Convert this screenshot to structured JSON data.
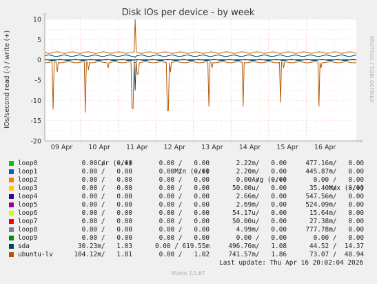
{
  "chart_data": {
    "type": "line",
    "title": "Disk IOs per device - by week",
    "ylabel": "IOs/second read (-) / write (+)",
    "ylim": [
      -20,
      10
    ],
    "yticks": [
      10,
      5,
      0,
      -5,
      -10,
      -15,
      -20
    ],
    "x_start_day": 8.55,
    "x_end_day": 16.83,
    "xticks": [
      {
        "label": "09 Apr",
        "day": 9.0
      },
      {
        "label": "10 Apr",
        "day": 10.0
      },
      {
        "label": "11 Apr",
        "day": 11.0
      },
      {
        "label": "12 Apr",
        "day": 12.0
      },
      {
        "label": "13 Apr",
        "day": 13.0
      },
      {
        "label": "14 Apr",
        "day": 14.0
      },
      {
        "label": "15 Apr",
        "day": 15.0
      },
      {
        "label": "16 Apr",
        "day": 16.0
      }
    ],
    "grid": true,
    "series": [
      {
        "name": "sda",
        "color": "#00465f",
        "write_level": 1.03,
        "read_level": -0.03,
        "spikes": [
          {
            "day": 10.95,
            "value": 0.6
          },
          {
            "day": 10.95,
            "value": -7.5
          }
        ]
      },
      {
        "name": "ubuntu-lv",
        "color": "#b35900",
        "write_level": 1.81,
        "read_level": -0.6,
        "spikes": [
          {
            "day": 8.78,
            "value": -12.2
          },
          {
            "day": 8.88,
            "value": -3.0
          },
          {
            "day": 9.63,
            "value": -13.0
          },
          {
            "day": 9.71,
            "value": -2.5
          },
          {
            "day": 10.23,
            "value": -2.0
          },
          {
            "day": 10.88,
            "value": -12.0
          },
          {
            "day": 10.95,
            "value": 10.0
          },
          {
            "day": 11.02,
            "value": -3.5
          },
          {
            "day": 11.82,
            "value": -12.5
          },
          {
            "day": 11.9,
            "value": -3.0
          },
          {
            "day": 12.92,
            "value": -11.5
          },
          {
            "day": 13.0,
            "value": -2.0
          },
          {
            "day": 13.83,
            "value": -11.5
          },
          {
            "day": 14.82,
            "value": -10.5
          },
          {
            "day": 14.9,
            "value": -2.0
          },
          {
            "day": 15.83,
            "value": -11.5
          },
          {
            "day": 15.9,
            "value": -2.0
          }
        ]
      },
      {
        "name": "loop0",
        "color": "#00cc00",
        "write_level": 0,
        "read_level": 0
      },
      {
        "name": "loop1",
        "color": "#0066b3",
        "write_level": 0,
        "read_level": 0
      },
      {
        "name": "loop2",
        "color": "#ff8000",
        "write_level": 0,
        "read_level": 0
      },
      {
        "name": "loop3",
        "color": "#ffcc00",
        "write_level": 0,
        "read_level": 0
      },
      {
        "name": "loop4",
        "color": "#330099",
        "write_level": 0,
        "read_level": 0
      },
      {
        "name": "loop5",
        "color": "#990099",
        "write_level": 0,
        "read_level": 0
      },
      {
        "name": "loop6",
        "color": "#ccff00",
        "write_level": 0,
        "read_level": 0
      },
      {
        "name": "loop7",
        "color": "#ff0000",
        "write_level": 0,
        "read_level": 0
      },
      {
        "name": "loop8",
        "color": "#808080",
        "write_level": 0,
        "read_level": 0
      },
      {
        "name": "loop9",
        "color": "#008f00",
        "write_level": 0,
        "read_level": 0
      }
    ]
  },
  "side_label": "RRDTOOL / TOBI OETIKER",
  "legend": {
    "headers": {
      "cur": "Cur (-/+)",
      "min": "Min (-/+)",
      "avg": "Avg (-/+)",
      "max": "Max (-/+)"
    },
    "rows": [
      {
        "name": "loop0",
        "color": "#00cc00",
        "cur": "0.00 /   0.00",
        "min": "0.00 /   0.00",
        "avg": "2.22m/   0.00",
        "max": "477.16m/   0.00"
      },
      {
        "name": "loop1",
        "color": "#0066b3",
        "cur": "0.00 /   0.00",
        "min": "0.00 /   0.00",
        "avg": "2.20m/   0.00",
        "max": "445.87m/   0.00"
      },
      {
        "name": "loop2",
        "color": "#ff8000",
        "cur": "0.00 /   0.00",
        "min": "0.00 /   0.00",
        "avg": "0.00 /   0.00",
        "max": "0.00 /   0.00"
      },
      {
        "name": "loop3",
        "color": "#ffcc00",
        "cur": "0.00 /   0.00",
        "min": "0.00 /   0.00",
        "avg": "50.00u/   0.00",
        "max": "35.40m/   0.00"
      },
      {
        "name": "loop4",
        "color": "#330099",
        "cur": "0.00 /   0.00",
        "min": "0.00 /   0.00",
        "avg": "2.66m/   0.00",
        "max": "547.56m/   0.00"
      },
      {
        "name": "loop5",
        "color": "#990099",
        "cur": "0.00 /   0.00",
        "min": "0.00 /   0.00",
        "avg": "2.69m/   0.00",
        "max": "524.09m/   0.00"
      },
      {
        "name": "loop6",
        "color": "#ccff00",
        "cur": "0.00 /   0.00",
        "min": "0.00 /   0.00",
        "avg": "54.17u/   0.00",
        "max": "15.64m/   0.00"
      },
      {
        "name": "loop7",
        "color": "#ff0000",
        "cur": "0.00 /   0.00",
        "min": "0.00 /   0.00",
        "avg": "50.00u/   0.00",
        "max": "27.38m/   0.00"
      },
      {
        "name": "loop8",
        "color": "#808080",
        "cur": "0.00 /   0.00",
        "min": "0.00 /   0.00",
        "avg": "4.99m/   0.00",
        "max": "777.78m/   0.00"
      },
      {
        "name": "loop9",
        "color": "#008f00",
        "cur": "0.00 /   0.00",
        "min": "0.00 /   0.00",
        "avg": "0.00 /   0.00",
        "max": "0.00 /   0.00"
      },
      {
        "name": "sda",
        "color": "#00465f",
        "cur": "30.23m/   1.03",
        "min": "0.00 / 619.55m",
        "avg": "496.76m/   1.08",
        "max": "44.52 /  14.37"
      },
      {
        "name": "ubuntu-lv",
        "color": "#b35900",
        "cur": "104.12m/   1.81",
        "min": "0.00 /   1.02",
        "avg": "741.57m/   1.86",
        "max": "73.07 /  48.94"
      }
    ],
    "last_update": "Last update: Thu Apr 16 20:02:04 2026"
  },
  "footer": "Munin 2.0.67"
}
